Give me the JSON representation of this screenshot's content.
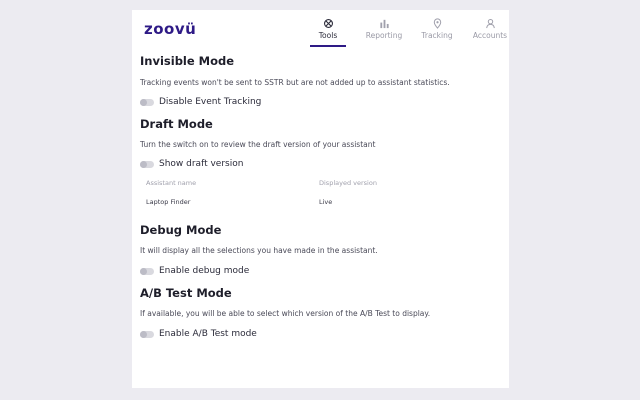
{
  "brand": {
    "logo": "zoovü"
  },
  "nav": [
    {
      "label": "Tools",
      "icon": "tools-icon",
      "active": true
    },
    {
      "label": "Reporting",
      "icon": "bar-chart-icon",
      "active": false
    },
    {
      "label": "Tracking",
      "icon": "location-pin-icon",
      "active": false
    },
    {
      "label": "Accounts",
      "icon": "user-icon",
      "active": false
    }
  ],
  "invisible": {
    "title": "Invisible Mode",
    "desc": "Tracking events won't be sent to SSTR but are not added up to assistant statistics.",
    "toggle": "Disable Event Tracking"
  },
  "draft": {
    "title": "Draft Mode",
    "desc": "Turn the switch on to review the draft version of your assistant",
    "toggle": "Show draft version",
    "table": {
      "headers": [
        "Assistant name",
        "Displayed version"
      ],
      "row": [
        "Laptop Finder",
        "Live"
      ]
    }
  },
  "debug": {
    "title": "Debug Mode",
    "desc": "It will display all the selections you have made in the assistant.",
    "toggle": "Enable debug mode"
  },
  "ab": {
    "title": "A/B Test Mode",
    "desc": "If available, you will be able to select which version of the A/B Test to display.",
    "toggle": "Enable A/B Test mode"
  },
  "colors": {
    "brand": "#2e1a86",
    "background": "#ecebf1",
    "panel": "#ffffff"
  }
}
